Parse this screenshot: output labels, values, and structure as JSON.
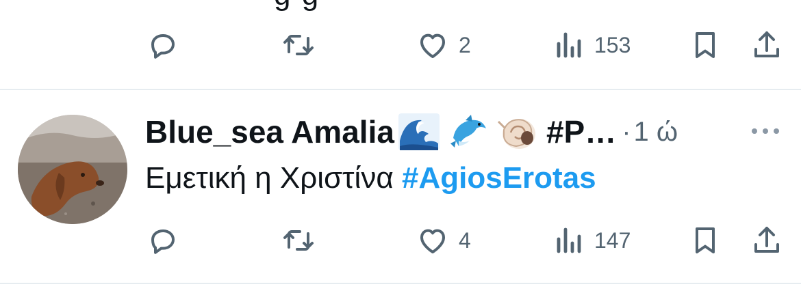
{
  "previous_tweet": {
    "clipped_text": "g        g",
    "actions": {
      "replies": "",
      "retweets": "",
      "likes": "2",
      "views": "153"
    }
  },
  "tweet": {
    "author_name": "Blue_sea Amalia",
    "author_emojis": [
      "water-wave-emoji",
      "dolphin-emoji",
      "spiral-shell-emoji"
    ],
    "author_hashtag_truncated": "#P…",
    "separator": "·",
    "time": "1 ώ",
    "text": "Εμετική η Χριστίνα ",
    "hashtag": "#AgiosErotas",
    "actions": {
      "replies": "",
      "retweets": "",
      "likes": "4",
      "views": "147"
    }
  },
  "colors": {
    "text": "#0f1419",
    "secondary": "#536471",
    "accent": "#1d9bf0",
    "divider": "#e6ecf0"
  },
  "icons": [
    "reply-icon",
    "retweet-icon",
    "like-icon",
    "views-icon",
    "bookmark-icon",
    "share-icon",
    "more-icon"
  ]
}
